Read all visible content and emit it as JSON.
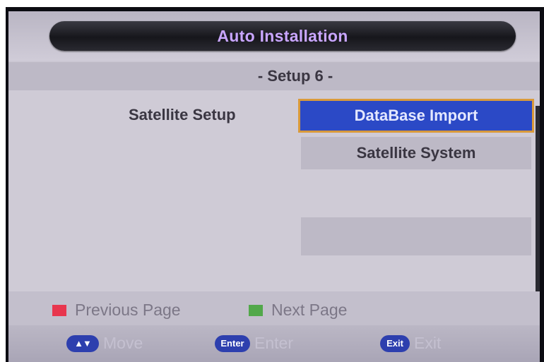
{
  "window": {
    "title": "Auto Installation",
    "subtitle": "- Setup 6 -"
  },
  "form": {
    "label": "Satellite Setup",
    "options": [
      "DataBase Import",
      "Satellite System",
      ""
    ],
    "selected_index": 0
  },
  "navigation": {
    "previous": {
      "label": "Previous Page",
      "color": "#e8364e"
    },
    "next": {
      "label": "Next Page",
      "color": "#52a84a"
    }
  },
  "hints": {
    "move": {
      "key": "▲▼",
      "label": "Move"
    },
    "enter": {
      "key": "Enter",
      "label": "Enter"
    },
    "exit": {
      "key": "Exit",
      "label": "Exit"
    }
  },
  "colors": {
    "accent_title": "#c9a6ff",
    "selection": "#2b49c6",
    "selection_border": "#d99a3b"
  }
}
